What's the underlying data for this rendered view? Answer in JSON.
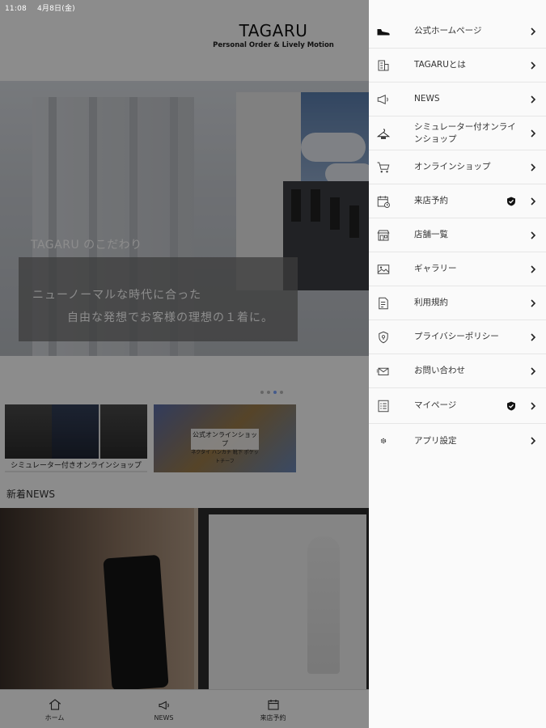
{
  "status_bar": {
    "time": "11:08",
    "date": "4月8日(金)"
  },
  "header": {
    "brand": "TAGARU",
    "tagline": "Personal Order & Lively Motion"
  },
  "hero": {
    "title": "TAGARU のこだわり",
    "line1": "ニューノーマルな時代に合った",
    "line2": "自由な発想でお客様の理想の１着に。",
    "slide_count": 4,
    "active_slide": 3
  },
  "banners": [
    {
      "label": "シミュレーター付きオンラインショップ"
    },
    {
      "label": "公式オンラインショップ",
      "sublabel": "ネクタイ ハンカチ 靴下 ポケットチーフ"
    }
  ],
  "news": {
    "heading": "新着NEWS"
  },
  "tabbar": [
    {
      "label": "ホーム",
      "icon": "home-icon"
    },
    {
      "label": "NEWS",
      "icon": "megaphone-icon"
    },
    {
      "label": "来店予約",
      "icon": "calendar-icon"
    },
    {
      "label": "",
      "icon": ""
    },
    {
      "label": "",
      "icon": ""
    }
  ],
  "menu": {
    "items": [
      {
        "label": "公式ホームページ",
        "icon": "shoe-icon",
        "badge": false
      },
      {
        "label": "TAGARUとは",
        "icon": "building-icon",
        "badge": false
      },
      {
        "label": "NEWS",
        "icon": "megaphone-icon",
        "badge": false
      },
      {
        "label": "シミュレーター付オンラインショップ",
        "icon": "hanger-icon",
        "badge": false
      },
      {
        "label": "オンラインショップ",
        "icon": "cart-icon",
        "badge": false
      },
      {
        "label": "来店予約",
        "icon": "calendar-icon",
        "badge": true
      },
      {
        "label": "店舗一覧",
        "icon": "storefront-icon",
        "badge": false
      },
      {
        "label": "ギャラリー",
        "icon": "image-icon",
        "badge": false
      },
      {
        "label": "利用規約",
        "icon": "document-icon",
        "badge": false
      },
      {
        "label": "プライバシーポリシー",
        "icon": "shield-icon",
        "badge": false
      },
      {
        "label": "お問い合わせ",
        "icon": "mail-icon",
        "badge": false
      },
      {
        "label": "マイページ",
        "icon": "list-icon",
        "badge": true
      },
      {
        "label": "アプリ設定",
        "icon": "gear-icon",
        "badge": false
      }
    ]
  }
}
